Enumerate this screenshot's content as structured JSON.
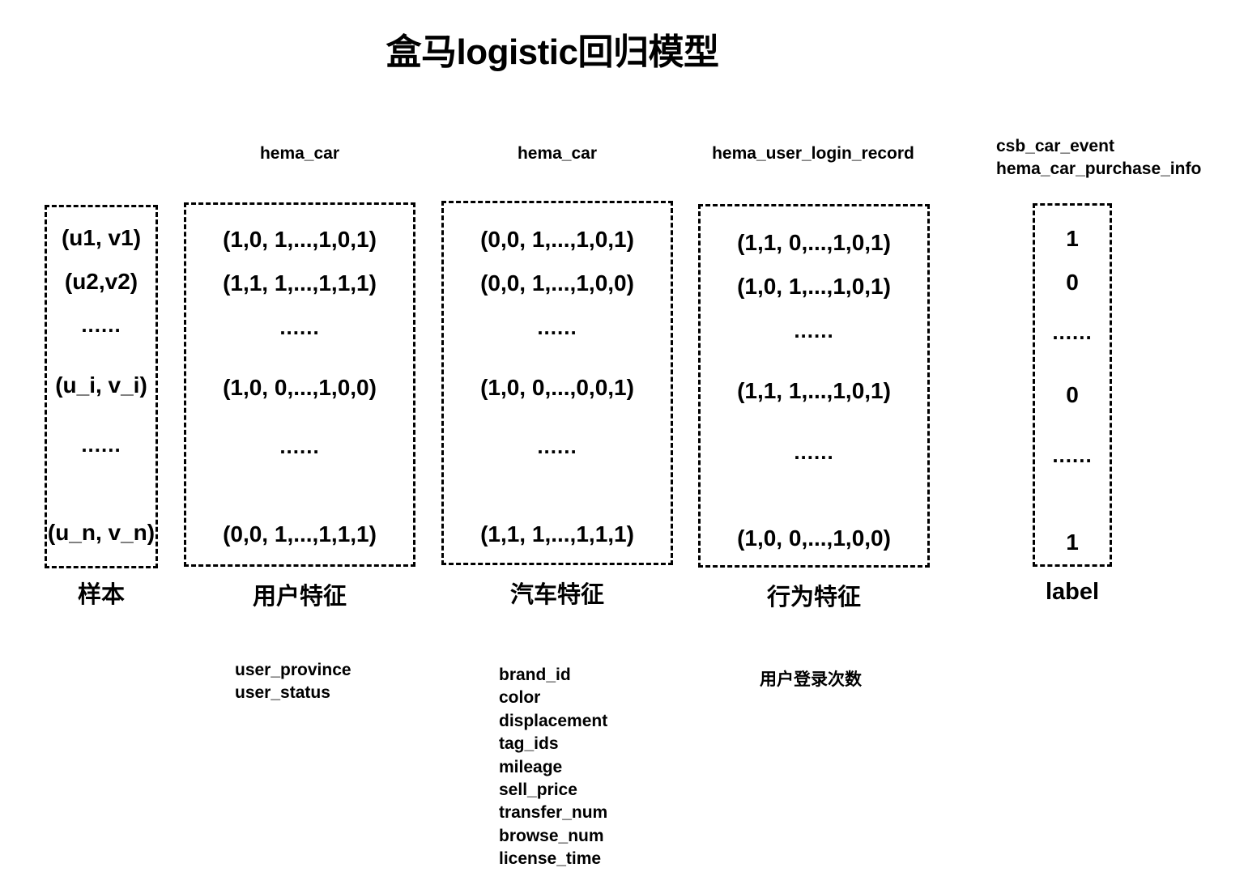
{
  "title": "盒马logistic回归模型",
  "sources": {
    "user": "hema_car",
    "car": "hema_car",
    "behavior": "hema_user_login_record",
    "label_line1": "csb_car_event",
    "label_line2": "hema_car_purchase_info"
  },
  "columns": {
    "sample": {
      "caption": "样本",
      "rows": [
        "(u1, v1)",
        "(u2,v2)",
        "......",
        "(u_i, v_i)",
        "......",
        "(u_n, v_n)"
      ]
    },
    "user": {
      "caption": "用户特征",
      "rows": [
        "(1,0, 1,...,1,0,1)",
        "(1,1, 1,...,1,1,1)",
        "......",
        "(1,0, 0,...,1,0,0)",
        "......",
        "(0,0, 1,...,1,1,1)"
      ],
      "fields": [
        "user_province",
        "user_status"
      ]
    },
    "car": {
      "caption": "汽车特征",
      "rows": [
        "(0,0, 1,...,1,0,1)",
        "(0,0, 1,...,1,0,0)",
        "......",
        "(1,0, 0,...,0,0,1)",
        "......",
        "(1,1, 1,...,1,1,1)"
      ],
      "fields": [
        "brand_id",
        "color",
        "displacement",
        "tag_ids",
        "mileage",
        "sell_price",
        "transfer_num",
        "browse_num",
        "license_time"
      ]
    },
    "behavior": {
      "caption": "行为特征",
      "rows": [
        "(1,1, 0,...,1,0,1)",
        "(1,0, 1,...,1,0,1)",
        "......",
        "(1,1, 1,...,1,0,1)",
        "......",
        "(1,0, 0,...,1,0,0)"
      ],
      "fields": [
        "用户登录次数"
      ]
    },
    "label": {
      "caption": "label",
      "rows": [
        "1",
        "0",
        "......",
        "0",
        "......",
        "1"
      ]
    }
  }
}
